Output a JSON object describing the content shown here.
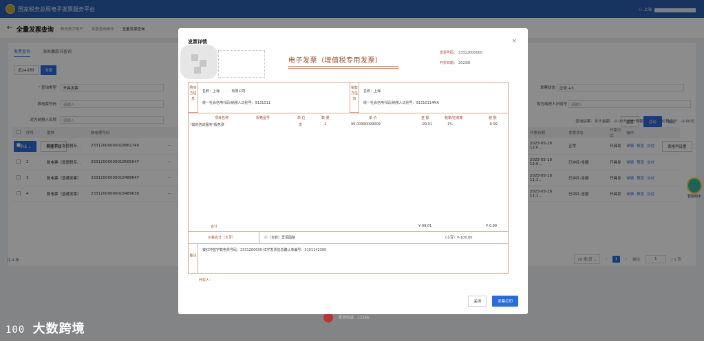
{
  "topbar": {
    "title": "国家税务总局电子发票服务平台",
    "user": "上海"
  },
  "header": {
    "back_icon": "arrow-left-icon",
    "title": "全量发票查询",
    "breadcrumbs": [
      "税务数字账户",
      "发票查询统计",
      "全量发票查询"
    ]
  },
  "tabs": [
    "发票查询",
    "海关缴款书查询"
  ],
  "range": {
    "label": "近24小时",
    "button": "全部"
  },
  "filters": {
    "row1": {
      "label": "* 查询类型",
      "value": "开具发票"
    },
    "row2": {
      "label": "数电票号码",
      "placeholder": "请输入"
    },
    "row3": {
      "label": "对方纳税人名称",
      "placeholder": "请输入"
    },
    "status_label": "发票状态",
    "status_value": "正常",
    "status_extra": "+3",
    "buyer_id_label": "购方纳税人识别号",
    "buyer_id_placeholder": "请输入"
  },
  "filter_buttons": {
    "reset": "重置",
    "search": "查询",
    "collapse": "收起"
  },
  "toolbar": {
    "export": "导出 ⌄",
    "batch_download": "批量下载",
    "customize_columns": "表格列设置"
  },
  "summary": {
    "amount": "查询结果：合计金额：-0.00元",
    "tax": "合计税额：-0.00元",
    "total": "价税合计：-0.00元"
  },
  "table": {
    "headers": [
      "序号",
      "票种",
      "数电票号码",
      "",
      "开票日期",
      "发票状态",
      "开票方式",
      "操作"
    ],
    "rows": [
      {
        "no": "1",
        "type": "数电票（增值税专…",
        "number": "23312000000018862740",
        "dash": "--",
        "date": "2023-05-18 12:0…",
        "status": "正常",
        "method": "开具发",
        "ops": [
          "详情",
          "预览",
          "交付"
        ]
      },
      {
        "no": "2",
        "type": "数电票（增值税专…",
        "number": "23312000000018565647",
        "dash": "--",
        "date": "2023-05-18 12:0…",
        "status": "已冲红-全额",
        "method": "开具发",
        "ops": [
          "详情",
          "预览",
          "交付"
        ]
      },
      {
        "no": "3",
        "type": "数电票（普通发票）",
        "number": "23312000000018488647",
        "dash": "--",
        "date": "2023-05-18 11:1…",
        "status": "已冲红-全额",
        "method": "开具发",
        "ops": [
          "详情",
          "预览",
          "交付"
        ]
      },
      {
        "no": "4",
        "type": "数电票（普通发票）",
        "number": "23312000000018489638",
        "dash": "--",
        "date": "2023-05-18 11:1…",
        "status": "已冲红-全额",
        "method": "开具发",
        "ops": [
          "详情",
          "预览",
          "交付"
        ]
      }
    ]
  },
  "pager": {
    "total": "共 4 条",
    "page_size": "10 条/页 ⌄",
    "prev": "‹",
    "page": "1",
    "next": "›",
    "goto_label": "前往",
    "goto_value": "1",
    "pages": "/ 1 页"
  },
  "assistant": {
    "label": "智能助手"
  },
  "footer": {
    "text": "查询电话：12366"
  },
  "watermark": {
    "mark": "100",
    "text": "大数跨境"
  },
  "modal": {
    "title": "发票详情",
    "close_icon": "close-icon",
    "invoice_title": "电子发票（增值税专用发票）",
    "number_label": "发票号码：",
    "number_value": "23312000000",
    "date_label": "开票日期：",
    "date_value": "2023年",
    "buyer_label": "购买方信息",
    "seller_label": "销售方信息",
    "buyer_name": "名称：上海",
    "buyer_name_suffix": "有限公司",
    "buyer_tax": "统一社会信用代码/纳税人识别号：9131011",
    "seller_name": "名称：上海",
    "seller_tax": "统一社会信用代码/纳税人识别号：91310114MA",
    "item_headers": [
      "项目名称",
      "规格型号",
      "单 位",
      "数 量",
      "单 价",
      "金 额",
      "税率/征收率",
      "税 额"
    ],
    "item": {
      "name": "*其他咨询服务*服务费",
      "unit": "次",
      "qty": "-1",
      "price": "99.00990099009",
      "amount": "-99.01",
      "rate": "1%",
      "tax": "-0.99"
    },
    "subtotal_label": "合计",
    "subtotal_amount": "¥-99.01",
    "subtotal_tax": "¥-0.99",
    "total_label": "价税合计（大写）",
    "total_words": "ⓧ（负数）壹佰圆整",
    "total_small": "（小写）¥-100.00",
    "remark_label": "备注",
    "remark_text": "被红冲蓝字数电票号码：2331200000        红字发票信息确认单编号：3101142300",
    "drawer_label": "开票人：",
    "btn_close": "关闭",
    "btn_print": "发票打印"
  }
}
